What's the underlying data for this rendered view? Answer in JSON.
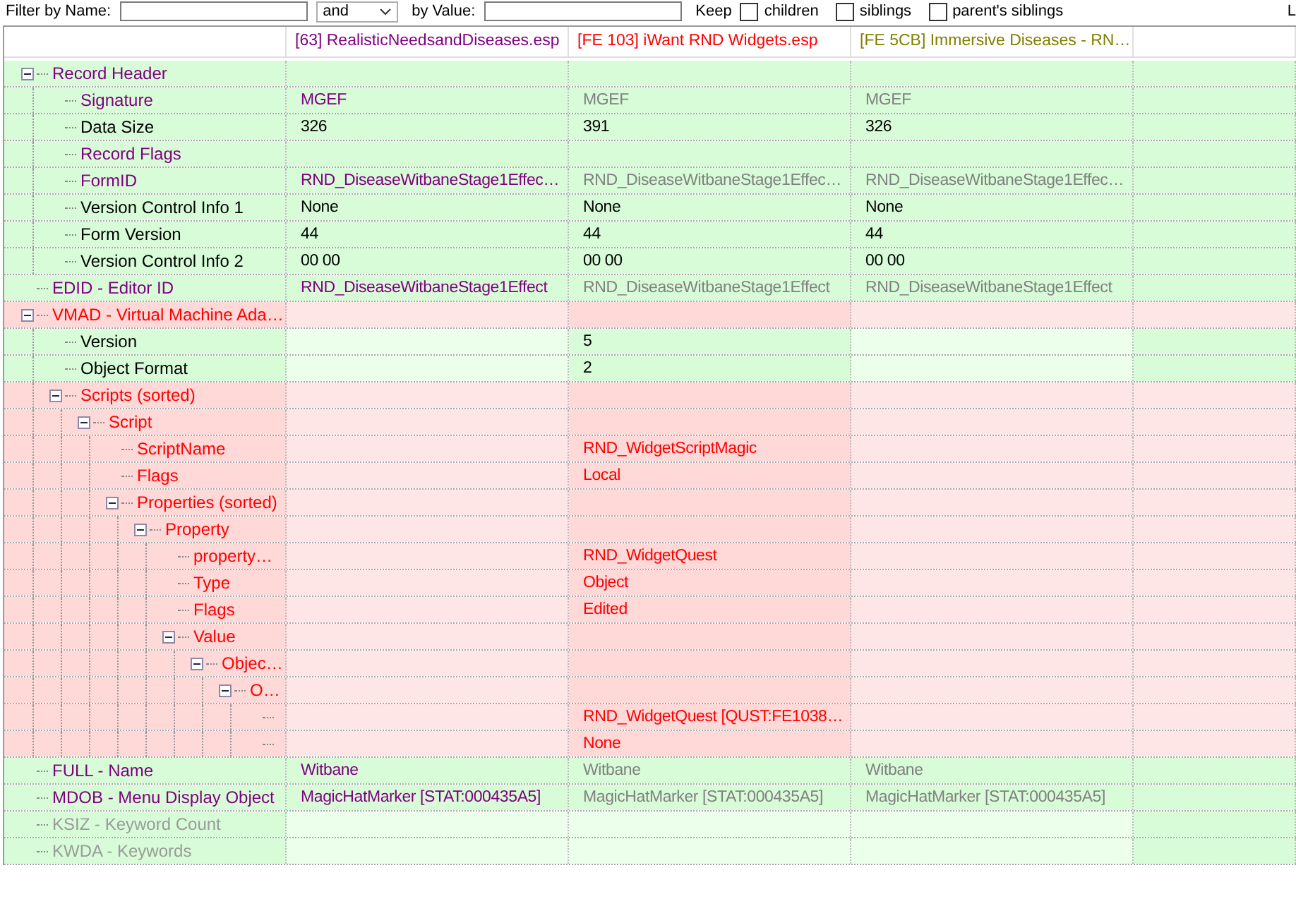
{
  "filter_bar": {
    "name_label": "Filter by Name:",
    "operator": {
      "value": "and"
    },
    "value_label": "by Value:",
    "keep_label": "Keep",
    "keep_options": [
      {
        "label": "children",
        "checked": false
      },
      {
        "label": "siblings",
        "checked": false
      },
      {
        "label": "parent's siblings",
        "checked": false
      }
    ],
    "cut_label": "L"
  },
  "columns": [
    {
      "label": "[63] RealisticNeedsandDiseases.esp",
      "color": "#800080"
    },
    {
      "label": "[FE 103] iWant RND Widgets.esp",
      "color": "#ff0000"
    },
    {
      "label": "[FE 5CB] Immersive Diseases - RN…",
      "color": "#808000"
    }
  ],
  "rows": [
    {
      "label": "Record Header",
      "kind": "override",
      "expanded": true,
      "values": [
        {
          "kind": "empty"
        },
        {
          "kind": "empty"
        },
        {
          "kind": "empty"
        }
      ],
      "children": [
        {
          "label": "Signature",
          "kind": "override",
          "values": [
            {
              "text": "MGEF",
              "kind": "override"
            },
            {
              "text": "MGEF",
              "kind": "dim"
            },
            {
              "text": "MGEF",
              "kind": "dim"
            }
          ]
        },
        {
          "label": "Data Size",
          "kind": "plain",
          "values": [
            {
              "text": "326",
              "kind": "plain"
            },
            {
              "text": "391",
              "kind": "plain"
            },
            {
              "text": "326",
              "kind": "plain"
            }
          ]
        },
        {
          "label": "Record Flags",
          "kind": "override",
          "values": [
            {
              "kind": "empty"
            },
            {
              "kind": "empty"
            },
            {
              "kind": "empty"
            }
          ]
        },
        {
          "label": "FormID",
          "kind": "override",
          "values": [
            {
              "text": "RND_DiseaseWitbaneStage1Effec…",
              "kind": "override"
            },
            {
              "text": "RND_DiseaseWitbaneStage1Effec…",
              "kind": "dim"
            },
            {
              "text": "RND_DiseaseWitbaneStage1Effec…",
              "kind": "dim"
            }
          ]
        },
        {
          "label": "Version Control Info 1",
          "kind": "plain",
          "values": [
            {
              "text": "None",
              "kind": "plain"
            },
            {
              "text": "None",
              "kind": "plain"
            },
            {
              "text": "None",
              "kind": "plain"
            }
          ]
        },
        {
          "label": "Form Version",
          "kind": "plain",
          "values": [
            {
              "text": "44",
              "kind": "plain"
            },
            {
              "text": "44",
              "kind": "plain"
            },
            {
              "text": "44",
              "kind": "plain"
            }
          ]
        },
        {
          "label": "Version Control Info 2",
          "kind": "plain",
          "values": [
            {
              "text": "00 00",
              "kind": "plain"
            },
            {
              "text": "00 00",
              "kind": "plain"
            },
            {
              "text": "00 00",
              "kind": "plain"
            }
          ]
        }
      ]
    },
    {
      "label": "EDID - Editor ID",
      "kind": "override",
      "values": [
        {
          "text": "RND_DiseaseWitbaneStage1Effect",
          "kind": "override"
        },
        {
          "text": "RND_DiseaseWitbaneStage1Effect",
          "kind": "dim"
        },
        {
          "text": "RND_DiseaseWitbaneStage1Effect",
          "kind": "dim"
        }
      ]
    },
    {
      "label": "VMAD - Virtual Machine Ada…",
      "kind": "conflict",
      "expanded": true,
      "values": [
        {
          "kind": "missing"
        },
        {
          "kind": "empty"
        },
        {
          "kind": "missing"
        }
      ],
      "children": [
        {
          "label": "Version",
          "kind": "plain",
          "values": [
            {
              "kind": "missing"
            },
            {
              "text": "5",
              "kind": "plain"
            },
            {
              "kind": "missing"
            }
          ]
        },
        {
          "label": "Object Format",
          "kind": "plain",
          "values": [
            {
              "kind": "missing"
            },
            {
              "text": "2",
              "kind": "plain"
            },
            {
              "kind": "missing"
            }
          ]
        },
        {
          "label": "Scripts (sorted)",
          "kind": "conflict",
          "expanded": true,
          "values": [
            {
              "kind": "missing"
            },
            {
              "kind": "empty"
            },
            {
              "kind": "missing"
            }
          ],
          "children": [
            {
              "label": "Script",
              "kind": "conflict",
              "expanded": true,
              "values": [
                {
                  "kind": "missing"
                },
                {
                  "kind": "empty"
                },
                {
                  "kind": "missing"
                }
              ],
              "children": [
                {
                  "label": "ScriptName",
                  "kind": "conflict",
                  "values": [
                    {
                      "kind": "missing"
                    },
                    {
                      "text": "RND_WidgetScriptMagic",
                      "kind": "conflict"
                    },
                    {
                      "kind": "missing"
                    }
                  ]
                },
                {
                  "label": "Flags",
                  "kind": "conflict",
                  "values": [
                    {
                      "kind": "missing"
                    },
                    {
                      "text": "Local",
                      "kind": "conflict"
                    },
                    {
                      "kind": "missing"
                    }
                  ]
                },
                {
                  "label": "Properties (sorted)",
                  "kind": "conflict",
                  "expanded": true,
                  "values": [
                    {
                      "kind": "missing"
                    },
                    {
                      "kind": "empty"
                    },
                    {
                      "kind": "missing"
                    }
                  ],
                  "children": [
                    {
                      "label": "Property",
                      "kind": "conflict",
                      "expanded": true,
                      "values": [
                        {
                          "kind": "missing"
                        },
                        {
                          "kind": "empty"
                        },
                        {
                          "kind": "missing"
                        }
                      ],
                      "children": [
                        {
                          "label": "property…",
                          "kind": "conflict",
                          "values": [
                            {
                              "kind": "missing"
                            },
                            {
                              "text": "RND_WidgetQuest",
                              "kind": "conflict"
                            },
                            {
                              "kind": "missing"
                            }
                          ]
                        },
                        {
                          "label": "Type",
                          "kind": "conflict",
                          "values": [
                            {
                              "kind": "missing"
                            },
                            {
                              "text": "Object",
                              "kind": "conflict"
                            },
                            {
                              "kind": "missing"
                            }
                          ]
                        },
                        {
                          "label": "Flags",
                          "kind": "conflict",
                          "values": [
                            {
                              "kind": "missing"
                            },
                            {
                              "text": "Edited",
                              "kind": "conflict"
                            },
                            {
                              "kind": "missing"
                            }
                          ]
                        },
                        {
                          "label": "Value",
                          "kind": "conflict",
                          "expanded": true,
                          "values": [
                            {
                              "kind": "missing"
                            },
                            {
                              "kind": "empty"
                            },
                            {
                              "kind": "missing"
                            }
                          ],
                          "children": [
                            {
                              "label": "Objec…",
                              "kind": "conflict",
                              "expanded": true,
                              "values": [
                                {
                                  "kind": "missing"
                                },
                                {
                                  "kind": "empty"
                                },
                                {
                                  "kind": "missing"
                                }
                              ],
                              "children": [
                                {
                                  "label": "O…",
                                  "kind": "conflict",
                                  "expanded": true,
                                  "values": [
                                    {
                                      "kind": "missing"
                                    },
                                    {
                                      "kind": "empty"
                                    },
                                    {
                                      "kind": "missing"
                                    }
                                  ],
                                  "children": [
                                    {
                                      "kind": "conflict",
                                      "values": [
                                        {
                                          "kind": "missing"
                                        },
                                        {
                                          "text": "RND_WidgetQuest [QUST:FE1038…",
                                          "kind": "conflict"
                                        },
                                        {
                                          "kind": "missing"
                                        }
                                      ]
                                    },
                                    {
                                      "kind": "conflict",
                                      "values": [
                                        {
                                          "kind": "missing"
                                        },
                                        {
                                          "text": "None",
                                          "kind": "conflict"
                                        },
                                        {
                                          "kind": "missing"
                                        }
                                      ]
                                    }
                                  ]
                                }
                              ]
                            }
                          ]
                        }
                      ]
                    }
                  ]
                }
              ]
            }
          ]
        }
      ]
    },
    {
      "label": "FULL - Name",
      "kind": "override",
      "values": [
        {
          "text": "Witbane",
          "kind": "override"
        },
        {
          "text": "Witbane",
          "kind": "dim"
        },
        {
          "text": "Witbane",
          "kind": "dim"
        }
      ]
    },
    {
      "label": "MDOB - Menu Display Object",
      "kind": "override",
      "values": [
        {
          "text": "MagicHatMarker [STAT:000435A5]",
          "kind": "override"
        },
        {
          "text": "MagicHatMarker [STAT:000435A5]",
          "kind": "dim"
        },
        {
          "text": "MagicHatMarker [STAT:000435A5]",
          "kind": "dim"
        }
      ]
    },
    {
      "label": "KSIZ - Keyword Count",
      "kind": "absent",
      "values": [
        {
          "kind": "missing"
        },
        {
          "kind": "missing"
        },
        {
          "kind": "missing"
        }
      ]
    },
    {
      "label": "KWDA - Keywords",
      "kind": "absent",
      "values": [
        {
          "kind": "missing"
        },
        {
          "kind": "missing"
        },
        {
          "kind": "missing"
        }
      ]
    }
  ]
}
